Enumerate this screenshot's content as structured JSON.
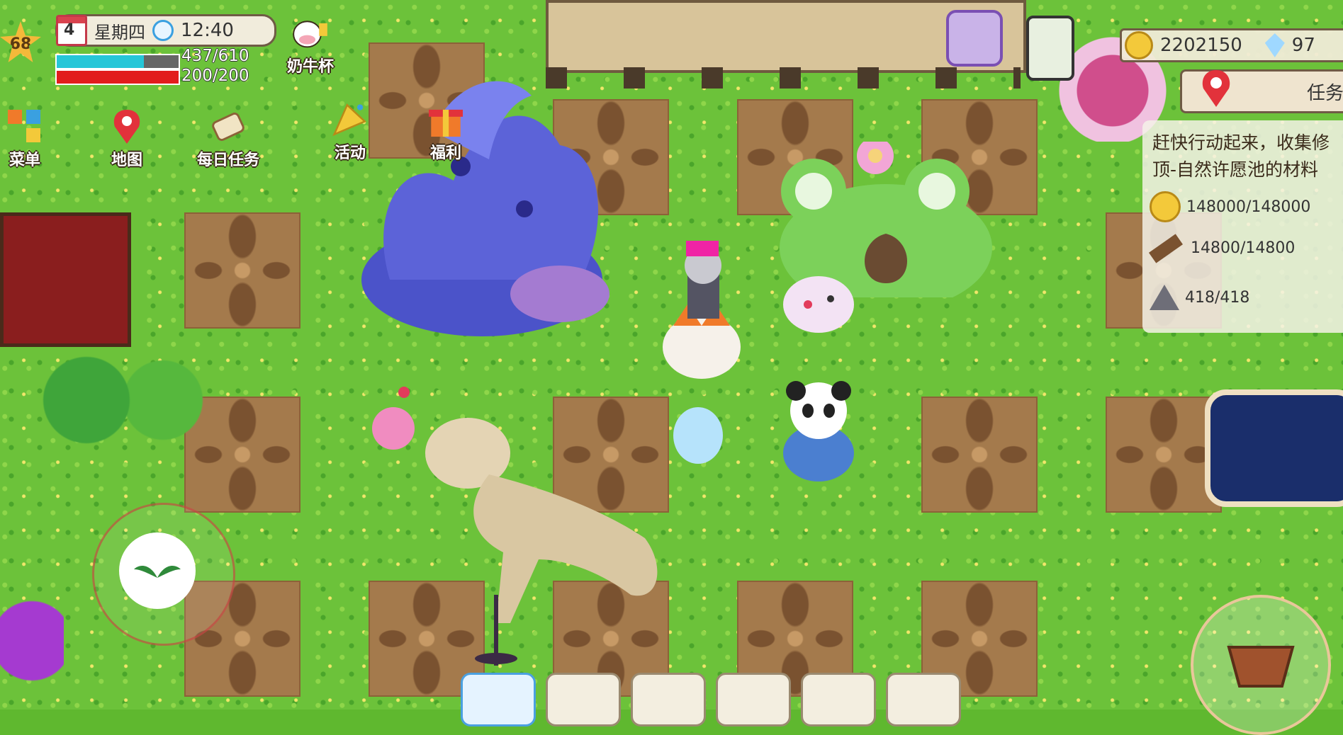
{
  "player": {
    "level": "68",
    "weekday": "星期四",
    "calendar_day": "4",
    "time": "12:40",
    "hp_text": "437/610",
    "hp_fraction": 0.716,
    "mp_text": "200/200",
    "mp_fraction": 1.0
  },
  "hud_menu": {
    "menu_label": "菜单",
    "map_label": "地图",
    "daily_label": "每日任务",
    "event_label": "活动",
    "welfare_label": "福利",
    "cup_label": "奶牛杯"
  },
  "currency": {
    "gold": "2202150",
    "gems": "97"
  },
  "quest": {
    "tab_label": "任务",
    "line1": "赶快行动起来，收集修",
    "line2": "顶-自然许愿池的材料",
    "req1": "148000/148000",
    "req2": "14800/14800",
    "req3": "418/418"
  },
  "colors": {
    "hp": "#26c6d8",
    "mp": "#e21d1d",
    "grass": "#6cc23a",
    "dirt": "#a47a4c"
  }
}
